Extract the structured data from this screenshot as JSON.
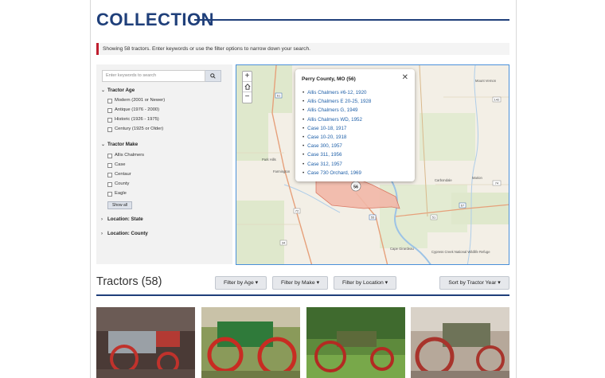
{
  "page": {
    "title": "COLLECTION"
  },
  "notice": {
    "text": "Showing 58 tractors. Enter keywords or use the filter options to narrow down your search."
  },
  "search": {
    "placeholder": "Enter keywords to search",
    "icon": "search-icon"
  },
  "facets": {
    "age": {
      "label": "Tractor Age",
      "options": [
        "Modern (2001 or Newer)",
        "Antique (1976 - 2000)",
        "Historic (1926 - 1975)",
        "Century (1925 or Older)"
      ]
    },
    "make": {
      "label": "Tractor Make",
      "options": [
        "Allis Chalmers",
        "Case",
        "Centaur",
        "County",
        "Eagle"
      ],
      "show_all": "Show all"
    },
    "state": {
      "label": "Location: State"
    },
    "county": {
      "label": "Location: County"
    }
  },
  "map": {
    "zoom_in": "+",
    "zoom_out": "−",
    "marker_count": "56",
    "highway_labels": [
      "61",
      "55",
      "142",
      "72",
      "51",
      "67",
      "34",
      "74"
    ],
    "place_labels": [
      "Park Hills",
      "Farmington",
      "Carbondale",
      "Marion",
      "Cape Girardeau",
      "Mount Vernon",
      "Cypress Creek National Wildlife Refuge"
    ],
    "popup": {
      "title": "Perry County, MO (56)",
      "close": "✕",
      "items": [
        "Allis Chalmers #6-12, 1920",
        "Allis Chalmers E 20-25, 1928",
        "Allis Chalmers G, 1949",
        "Allis Chalmers WD, 1952",
        "Case 10-18, 1917",
        "Case 10-20, 1918",
        "Case 300, 1957",
        "Case 311, 1956",
        "Case 312, 1957",
        "Case 730 Orchard, 1969"
      ]
    }
  },
  "results": {
    "title": "Tractors (58)",
    "filters": [
      "Filter by Age ▾",
      "Filter by Make ▾",
      "Filter by Location ▾"
    ],
    "sort": "Sort by Tractor Year ▾"
  },
  "colors": {
    "brand": "#1f3f7a",
    "accent": "#c01e2e",
    "link": "#1e5fa8",
    "county_fill": "#f2b8a8"
  }
}
